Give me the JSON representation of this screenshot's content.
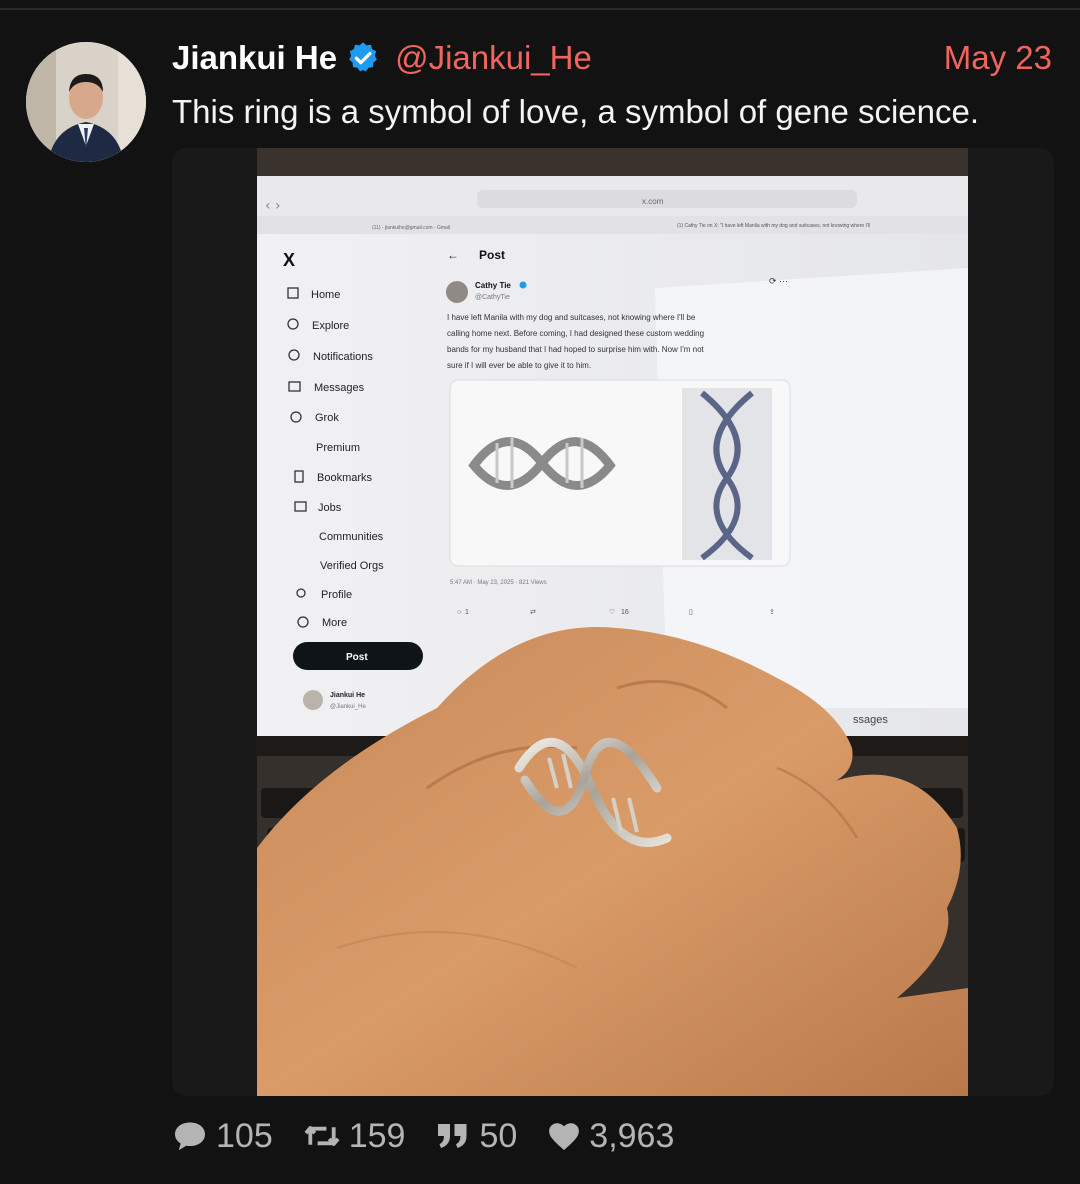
{
  "post": {
    "author_name": "Jiankui He",
    "handle": "@Jiankui_He",
    "date": "May 23",
    "text": "This ring is a symbol of love, a symbol of gene science."
  },
  "screen": {
    "url": "x.com",
    "tab1": "(11) - jiankuihe@gmail.com - Gmail",
    "tab2": "(1) Cathy Tie on X: \"I have left Manila with my dog and suitcases, not knowing where I'll",
    "page_title": "Post",
    "nav": [
      "Home",
      "Explore",
      "Notifications",
      "Messages",
      "Grok",
      "Premium",
      "Bookmarks",
      "Jobs",
      "Communities",
      "Verified Orgs",
      "Profile",
      "More"
    ],
    "post_button": "Post",
    "account_name": "Jiankui He",
    "account_handle": "@Jiankui_He",
    "tweet_author": "Cathy Tie",
    "tweet_handle": "@CathyTie",
    "tweet_text": [
      "I have left Manila with my dog and suitcases, not knowing where I'll be",
      "calling home next. Before coming, I had designed these custom wedding",
      "bands for my husband that I had hoped to surprise him with. Now I'm not",
      "sure if I will ever be able to give it to him."
    ],
    "tweet_meta": "5:47 AM · May 23, 2025 · 821 Views",
    "reply_count": "1",
    "like_count": "16",
    "messages_label": "ssages"
  },
  "stats": {
    "replies": "105",
    "retweets": "159",
    "quotes": "50",
    "likes": "3,963"
  },
  "colors": {
    "background": "#121212",
    "accent": "#f0655d",
    "verified": "#1d9bf0",
    "stat_text": "#b4b4b4"
  },
  "icons": [
    "verified-badge-icon",
    "reply-icon",
    "retweet-icon",
    "quote-icon",
    "heart-icon"
  ]
}
